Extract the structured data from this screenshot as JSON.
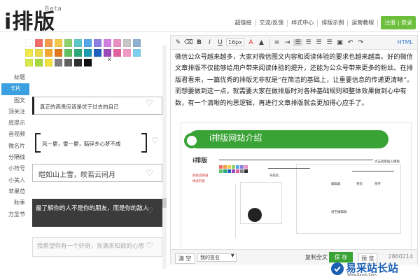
{
  "header": {
    "logo": "i排版",
    "beta": "Beta",
    "nav": [
      "超链接",
      "交流/反馈",
      "样式中心",
      "排版示例",
      "运营教程"
    ],
    "login": "注册 | 登录"
  },
  "palette": {
    "close": "x",
    "rows": [
      [
        "#ffffff",
        "#f26b6b",
        "#f29b4a",
        "#f2c94a",
        "#8fd16a",
        "#5ec8c8",
        "#55a7e8",
        "#8a7fe0",
        "#d07fe0",
        "#e890c0",
        "#c6c6c6",
        "#8fb0d0"
      ],
      [
        "#f2e84a",
        "#e8d84a",
        "#f0a830",
        "#e07820",
        "#60c060",
        "#2aa878",
        "#1c9cb0",
        "#2060c0",
        "#9a4ab8",
        "#e060a0",
        "#f49ac8",
        "#7fd0f0"
      ],
      [
        "#d6e84a",
        "#a8d840",
        "#f0e040",
        "#808080",
        "#606060",
        "#303030",
        "#101010"
      ]
    ]
  },
  "categories": [
    "标题",
    "卡片",
    "图文",
    "顶关注",
    "底提示",
    "音视频",
    "微名片",
    "分隔线",
    "小符号",
    "小美人",
    "苹果范",
    "秋季",
    "万圣节"
  ],
  "active_category": 1,
  "cards": {
    "c1": "真正的高贵应该是优于过去的自己",
    "c2": "风一更，雪一更，聒碎乡心梦不成",
    "c3": "皑如山上雪，皎若云间月",
    "c4": "最了解你的人不是你的朋友，而是你的敌人",
    "c5": "我希望你有一个好奇，充满求知欲的心思"
  },
  "toolbar": {
    "size": "16px",
    "html": "HTML"
  },
  "editor": {
    "paragraph": "微信公众号越来越多，大家对微信图文内容和阅读体验的要求也越来越高。好的微信文章排版不仅能够给用户带来阅读体验的提升，还能为公众号带来更多的粉丝。在排版君看来，一篇优秀的排版无非就是“在简洁的基础上，让重要信息的传递更清晰”。而想要做到这一点，就需要大家在做排版时对各种基础规则和整体效果做到心中有数，有一个清晰的构思逻辑，再进行文章排版就会更加得心应手了。",
    "banner_title": "i排版网站介绍",
    "mini_logo": "i排版",
    "mini_labels": [
      "点击直接插入模板",
      "颜色选择器",
      "导航栏",
      "编辑器",
      "样式列表",
      "预览",
      "保存",
      "清空编辑器"
    ]
  },
  "footer": {
    "clear": "清 空",
    "signature": "我的签名",
    "copy": "复制全文",
    "save": "保 存",
    "preview": "预 览",
    "count": "2860214"
  },
  "watermark": {
    "text": "易采站长站",
    "sub": "Www.Easck.Com"
  }
}
